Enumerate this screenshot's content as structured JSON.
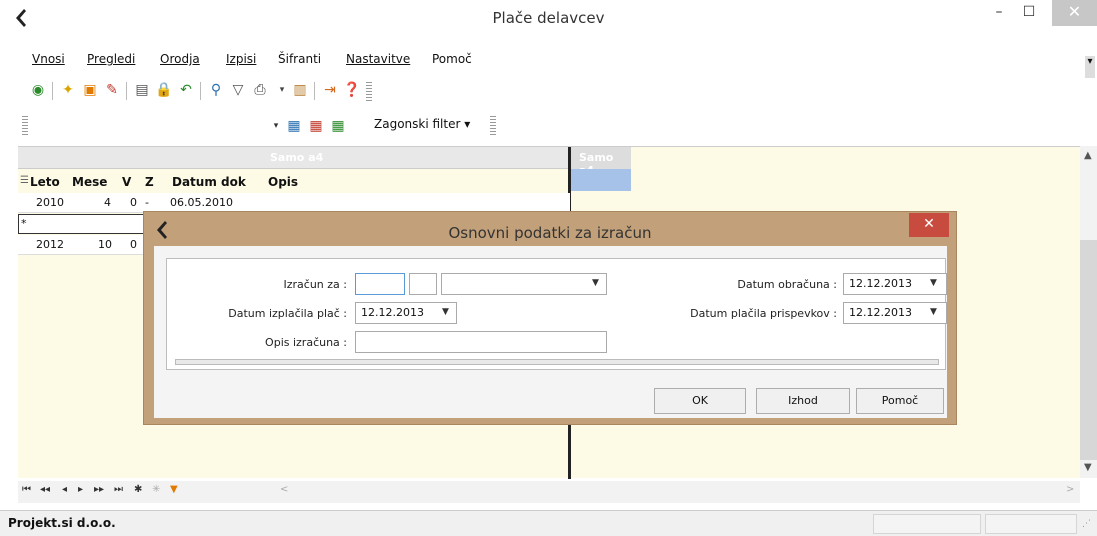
{
  "window": {
    "title": "Plače delavcev",
    "min_glyph": "–",
    "max_glyph": "☐",
    "close_glyph": "✕",
    "logo_glyph": "❮"
  },
  "menu": {
    "items": [
      "Vnosi",
      "Pregledi",
      "Orodja",
      "Izpisi",
      "Šifranti",
      "Nastavitve",
      "Pomoč"
    ]
  },
  "toolbar": {
    "filter_label": "Zagonski filter ▾",
    "icons": [
      "refresh-icon",
      "new-icon",
      "export-icon",
      "edit-icon",
      "calculator-icon",
      "lock-icon",
      "undo-icon",
      "search-icon",
      "filter-icon",
      "print-icon",
      "book-icon",
      "exit-icon",
      "help-icon"
    ]
  },
  "grid": {
    "band_left": "Samo a4",
    "band_right": "Samo a4",
    "columns": [
      "Leto",
      "Mese",
      "V",
      "Z",
      "Datum dok",
      "Opis"
    ],
    "rows": [
      {
        "leto": "2010",
        "mesec": "4",
        "v": "0",
        "z": "-",
        "datum": "06.05.2010",
        "opis": ""
      },
      {
        "leto": "",
        "mesec": "",
        "v": "",
        "z": "",
        "datum": "",
        "opis": ""
      },
      {
        "leto": "2012",
        "mesec": "10",
        "v": "0",
        "z": "",
        "datum": "",
        "opis": ""
      }
    ],
    "new_row_marker": "*"
  },
  "navbar": {
    "buttons": [
      "⏮",
      "◂◂",
      "◂",
      "▸",
      "▸▸",
      "⏭",
      "✱",
      "✳",
      "▼"
    ],
    "scroll_left": "<",
    "scroll_right": ">"
  },
  "status": {
    "company": "Projekt.si d.o.o."
  },
  "dialog": {
    "title": "Osnovni podatki za izračun",
    "close_glyph": "✕",
    "izracun_label": "Izračun za :",
    "izracun_value": "",
    "izplacila_label": "Datum izplačila plač :",
    "izplacila_value": "12.12.2013",
    "opis_label": "Opis izračuna :",
    "opis_value": "",
    "obracuna_label": "Datum obračuna :",
    "obracuna_value": "12.12.2013",
    "prispevkov_label": "Datum plačila prispevkov :",
    "prispevkov_value": "12.12.2013",
    "ok_label": "OK",
    "izhod_label": "Izhod",
    "pomoc_label": "Pomoč"
  },
  "colors": {
    "dialog_frame": "#c2a07a",
    "grid_background": "#fdfbe6",
    "close_red": "#c84b3f",
    "selection_blue": "#a7c2e8"
  }
}
